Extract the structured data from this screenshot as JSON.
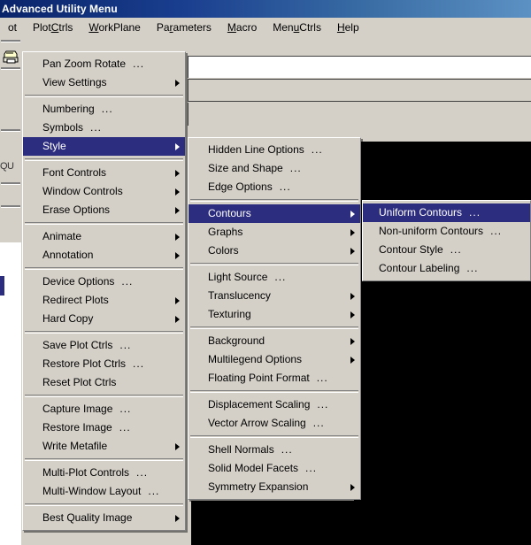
{
  "window": {
    "title": "Advanced Utility Menu"
  },
  "menubar": {
    "items": [
      {
        "label": "ot",
        "mnemonic": ""
      },
      {
        "label": "PlotCtrls",
        "mnemonic": "C"
      },
      {
        "label": "WorkPlane",
        "mnemonic": "W"
      },
      {
        "label": "Parameters",
        "mnemonic": "r"
      },
      {
        "label": "Macro",
        "mnemonic": "M"
      },
      {
        "label": "MenuCtrls",
        "mnemonic": "u"
      },
      {
        "label": "Help",
        "mnemonic": "H"
      }
    ]
  },
  "toolbar": {
    "printer_icon": "printer-icon",
    "quit_label": "QU"
  },
  "plotctrls_menu": {
    "items": [
      {
        "label": "Pan Zoom Rotate",
        "dots": "...",
        "arrow": false,
        "selected": false
      },
      {
        "label": "View Settings",
        "dots": "",
        "arrow": true,
        "selected": false
      },
      {
        "separator": true
      },
      {
        "label": "Numbering",
        "dots": "...",
        "arrow": false,
        "selected": false
      },
      {
        "label": "Symbols",
        "dots": "...",
        "arrow": false,
        "selected": false
      },
      {
        "label": "Style",
        "dots": "",
        "arrow": true,
        "selected": true
      },
      {
        "separator": true
      },
      {
        "label": "Font Controls",
        "dots": "",
        "arrow": true,
        "selected": false
      },
      {
        "label": "Window Controls",
        "dots": "",
        "arrow": true,
        "selected": false
      },
      {
        "label": "Erase Options",
        "dots": "",
        "arrow": true,
        "selected": false
      },
      {
        "separator": true
      },
      {
        "label": "Animate",
        "dots": "",
        "arrow": true,
        "selected": false
      },
      {
        "label": "Annotation",
        "dots": "",
        "arrow": true,
        "selected": false
      },
      {
        "separator": true
      },
      {
        "label": "Device Options",
        "dots": "...",
        "arrow": false,
        "selected": false
      },
      {
        "label": "Redirect Plots",
        "dots": "",
        "arrow": true,
        "selected": false
      },
      {
        "label": "Hard Copy",
        "dots": "",
        "arrow": true,
        "selected": false
      },
      {
        "separator": true
      },
      {
        "label": "Save Plot Ctrls",
        "dots": "...",
        "arrow": false,
        "selected": false
      },
      {
        "label": "Restore Plot Ctrls",
        "dots": "...",
        "arrow": false,
        "selected": false
      },
      {
        "label": "Reset Plot Ctrls",
        "dots": "",
        "arrow": false,
        "selected": false
      },
      {
        "separator": true
      },
      {
        "label": "Capture Image",
        "dots": "...",
        "arrow": false,
        "selected": false
      },
      {
        "label": "Restore Image",
        "dots": "...",
        "arrow": false,
        "selected": false
      },
      {
        "label": "Write Metafile",
        "dots": "",
        "arrow": true,
        "selected": false
      },
      {
        "separator": true
      },
      {
        "label": "Multi-Plot Controls",
        "dots": "...",
        "arrow": false,
        "selected": false
      },
      {
        "label": "Multi-Window Layout",
        "dots": "...",
        "arrow": false,
        "selected": false
      },
      {
        "separator": true
      },
      {
        "label": "Best Quality Image",
        "dots": "",
        "arrow": true,
        "selected": false
      }
    ]
  },
  "style_menu": {
    "items": [
      {
        "label": "Hidden Line Options",
        "dots": "...",
        "arrow": false,
        "selected": false
      },
      {
        "label": "Size and Shape",
        "dots": "...",
        "arrow": false,
        "selected": false
      },
      {
        "label": "Edge Options",
        "dots": "...",
        "arrow": false,
        "selected": false
      },
      {
        "separator": true
      },
      {
        "label": "Contours",
        "dots": "",
        "arrow": true,
        "selected": true
      },
      {
        "label": "Graphs",
        "dots": "",
        "arrow": true,
        "selected": false
      },
      {
        "label": "Colors",
        "dots": "",
        "arrow": true,
        "selected": false
      },
      {
        "separator": true
      },
      {
        "label": "Light Source",
        "dots": "...",
        "arrow": false,
        "selected": false
      },
      {
        "label": "Translucency",
        "dots": "",
        "arrow": true,
        "selected": false
      },
      {
        "label": "Texturing",
        "dots": "",
        "arrow": true,
        "selected": false
      },
      {
        "separator": true
      },
      {
        "label": "Background",
        "dots": "",
        "arrow": true,
        "selected": false
      },
      {
        "label": "Multilegend Options",
        "dots": "",
        "arrow": true,
        "selected": false
      },
      {
        "label": "Floating Point Format",
        "dots": "...",
        "arrow": false,
        "selected": false
      },
      {
        "separator": true
      },
      {
        "label": "Displacement Scaling",
        "dots": "...",
        "arrow": false,
        "selected": false
      },
      {
        "label": "Vector Arrow Scaling",
        "dots": "...",
        "arrow": false,
        "selected": false
      },
      {
        "separator": true
      },
      {
        "label": "Shell Normals",
        "dots": "...",
        "arrow": false,
        "selected": false
      },
      {
        "label": "Solid Model Facets",
        "dots": "...",
        "arrow": false,
        "selected": false
      },
      {
        "label": "Symmetry Expansion",
        "dots": "",
        "arrow": true,
        "selected": false
      }
    ]
  },
  "contours_menu": {
    "items": [
      {
        "label": "Uniform Contours",
        "dots": "...",
        "arrow": false,
        "selected": true
      },
      {
        "label": "Non-uniform Contours",
        "dots": "...",
        "arrow": false,
        "selected": false
      },
      {
        "label": "Contour Style",
        "dots": "...",
        "arrow": false,
        "selected": false
      },
      {
        "label": "Contour Labeling",
        "dots": "...",
        "arrow": false,
        "selected": false
      }
    ]
  },
  "colors": {
    "menu_face": "#d4d0c8",
    "highlight": "#2d2d80",
    "highlight_text": "#ffffff",
    "titlebar_start": "#0a246a",
    "titlebar_end": "#5c91c4",
    "graphics_background": "#000000"
  }
}
